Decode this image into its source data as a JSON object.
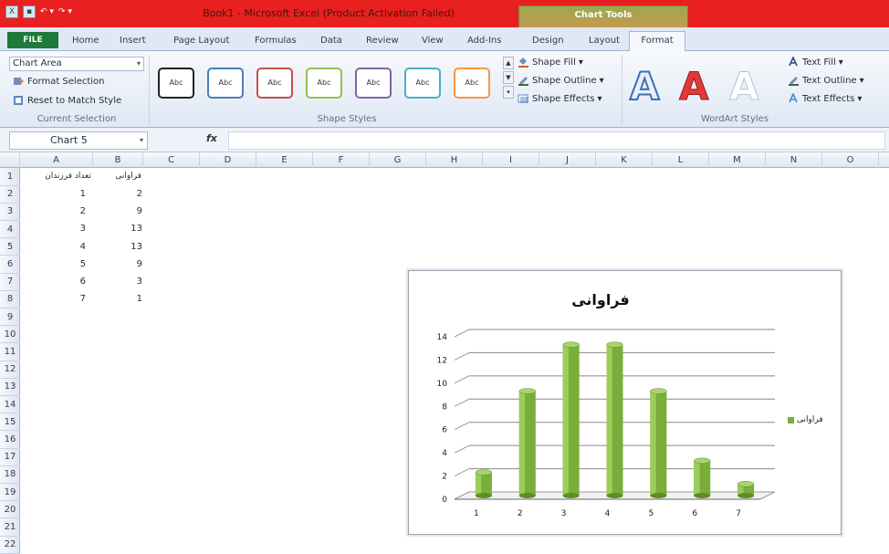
{
  "title_bar": {
    "app_title": "Book1 - Microsoft Excel (Product Activation Failed)",
    "context_tab": "Chart Tools"
  },
  "tabs": [
    "Home",
    "Insert",
    "Page Layout",
    "Formulas",
    "Data",
    "Review",
    "View",
    "Add-Ins",
    "Design",
    "Layout"
  ],
  "file_tab": "FILE",
  "active_tab": "Format",
  "ribbon": {
    "current_selection": {
      "selected": "Chart Area",
      "format_selection": "Format Selection",
      "reset_style": "Reset to Match Style",
      "label": "Current Selection"
    },
    "shape_styles": {
      "swatch_text": "Abc",
      "swatch_colors": [
        "#222222",
        "#4a7ebb",
        "#c0504d",
        "#9bbb59",
        "#8064a2",
        "#4bacc6",
        "#f79646"
      ],
      "shape_fill": "Shape Fill",
      "shape_outline": "Shape Outline",
      "shape_effects": "Shape Effects",
      "label": "Shape Styles"
    },
    "wordart_styles": {
      "glyph": "A",
      "text_fill": "Text Fill",
      "text_outline": "Text Outline",
      "text_effects": "Text Effects",
      "label": "WordArt Styles"
    }
  },
  "formula_bar": {
    "name_box": "Chart 5",
    "fx": "fx",
    "value": ""
  },
  "columns": [
    "A",
    "B",
    "C",
    "D",
    "E",
    "F",
    "G",
    "H",
    "I",
    "J",
    "K",
    "L",
    "M",
    "N",
    "O"
  ],
  "rows": [
    "1",
    "2",
    "3",
    "4",
    "5",
    "6",
    "7",
    "8",
    "9",
    "10",
    "11",
    "12",
    "13",
    "14",
    "15",
    "16",
    "17",
    "18",
    "19",
    "20",
    "21",
    "22"
  ],
  "sheet": {
    "header_a": "تعداد فرزندان",
    "header_b": "فراوانی",
    "col_a": [
      1,
      2,
      3,
      4,
      5,
      6,
      7
    ],
    "col_b": [
      2,
      9,
      13,
      13,
      9,
      3,
      1
    ]
  },
  "chart_data": {
    "type": "bar",
    "title": "فراوانی",
    "categories": [
      "1",
      "2",
      "3",
      "4",
      "5",
      "6",
      "7"
    ],
    "series": [
      {
        "name": "فراوانی",
        "values": [
          2,
          9,
          13,
          13,
          9,
          3,
          1
        ]
      }
    ],
    "ylim": [
      0,
      14
    ],
    "y_ticks": [
      0,
      2,
      4,
      6,
      8,
      10,
      12,
      14
    ],
    "grid": true,
    "legend_position": "right",
    "bar_color": "#7aad3a"
  }
}
